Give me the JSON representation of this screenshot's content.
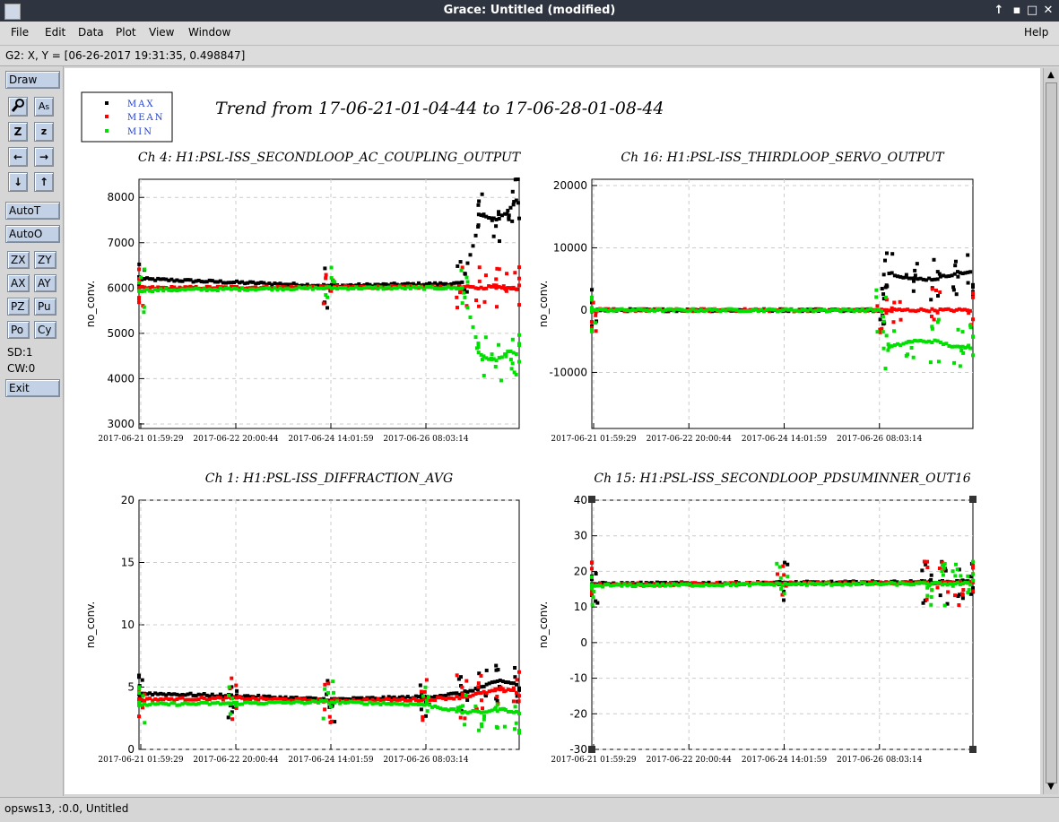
{
  "window": {
    "title": "Grace: Untitled (modified)"
  },
  "menu": [
    "File",
    "Edit",
    "Data",
    "Plot",
    "View",
    "Window"
  ],
  "menu_help": "Help",
  "coord_readout": "G2: X, Y = [06-26-2017 19:31:35, 0.498847]",
  "toolbar": {
    "draw": "Draw",
    "autot": "AutoT",
    "autoo": "AutoO",
    "zx": "ZX",
    "zy": "ZY",
    "ax": "AX",
    "ay": "AY",
    "pz": "PZ",
    "pu": "Pu",
    "po": "Po",
    "cy": "Cy",
    "sd": "SD:1",
    "cw": "CW:0",
    "exit": "Exit"
  },
  "status": "opsws13, :0.0, Untitled",
  "figure": {
    "title": "Trend from 17-06-21-01-04-44 to 17-06-28-01-08-44",
    "legend": [
      {
        "label": "MAX",
        "color": "#000000"
      },
      {
        "label": "MEAN",
        "color": "#ff0000"
      },
      {
        "label": "MIN",
        "color": "#00e000"
      }
    ]
  },
  "chart_data": [
    {
      "type": "scatter",
      "title": "Ch 4: H1:PSL-ISS_SECONDLOOP_AC_COUPLING_OUTPUT",
      "xlabel": "",
      "ylabel": "no_conv.",
      "ylim": [
        2900,
        8400
      ],
      "yticks": [
        3000,
        4000,
        5000,
        6000,
        7000,
        8000
      ],
      "xticks": [
        "2017-06-21 01:59:29",
        "2017-06-22 20:00:44",
        "2017-06-24 14:01:59",
        "2017-06-26 08:03:14"
      ],
      "grid": true,
      "series": [
        {
          "name": "MAX",
          "baseline": 6050,
          "x": [
            0.0,
            0.5,
            0.85,
            0.9,
            0.94,
            0.97,
            1.0
          ],
          "y": [
            6200,
            6050,
            6100,
            7600,
            7500,
            7700,
            8000
          ]
        },
        {
          "name": "MEAN",
          "baseline": 6000,
          "x": [
            0.0,
            0.5,
            0.85,
            0.9,
            0.94,
            0.97,
            1.0
          ],
          "y": [
            6000,
            6020,
            6020,
            6000,
            6050,
            6000,
            6000
          ]
        },
        {
          "name": "MIN",
          "baseline": 5980,
          "x": [
            0.0,
            0.5,
            0.85,
            0.9,
            0.94,
            0.97,
            1.0
          ],
          "y": [
            5950,
            6000,
            6000,
            4500,
            4400,
            4600,
            4500
          ]
        }
      ]
    },
    {
      "type": "scatter",
      "title": "Ch 16: H1:PSL-ISS_THIRDLOOP_SERVO_OUTPUT",
      "xlabel": "",
      "ylabel": "no_conv.",
      "ylim": [
        -19000,
        21000
      ],
      "yticks": [
        -10000,
        0,
        10000,
        20000
      ],
      "xticks": [
        "2017-06-21 01:59:29",
        "2017-06-22 20:00:44",
        "2017-06-24 14:01:59",
        "2017-06-26 08:03:14"
      ],
      "grid": true,
      "series": [
        {
          "name": "MAX",
          "baseline": 0,
          "x": [
            0.0,
            0.76,
            0.78,
            0.84,
            0.9,
            0.96,
            1.0
          ],
          "y": [
            0,
            0,
            6000,
            5000,
            5000,
            6000,
            6000
          ]
        },
        {
          "name": "MEAN",
          "baseline": 0,
          "x": [
            0.0,
            0.76,
            0.8,
            0.9,
            1.0
          ],
          "y": [
            0,
            0,
            0,
            0,
            0
          ]
        },
        {
          "name": "MIN",
          "baseline": 0,
          "x": [
            0.0,
            0.76,
            0.78,
            0.84,
            0.9,
            0.96,
            1.0
          ],
          "y": [
            0,
            0,
            -6000,
            -5000,
            -5000,
            -6000,
            -6000
          ]
        }
      ]
    },
    {
      "type": "scatter",
      "title": "Ch 1: H1:PSL-ISS_DIFFRACTION_AVG",
      "xlabel": "",
      "ylabel": "no_conv.",
      "ylim": [
        0,
        20
      ],
      "yticks": [
        0,
        5,
        10,
        15,
        20
      ],
      "xticks": [
        "2017-06-21 01:59:29",
        "2017-06-22 20:00:44",
        "2017-06-24 14:01:59",
        "2017-06-26 08:03:14"
      ],
      "grid": true,
      "series": [
        {
          "name": "MAX",
          "baseline": 4.2,
          "x": [
            0.0,
            0.25,
            0.5,
            0.75,
            0.85,
            0.9,
            0.95,
            1.0
          ],
          "y": [
            4.5,
            4.3,
            4.0,
            4.2,
            4.5,
            5.0,
            5.5,
            5.2
          ]
        },
        {
          "name": "MEAN",
          "baseline": 4.0,
          "x": [
            0.0,
            0.25,
            0.5,
            0.75,
            0.85,
            0.9,
            0.95,
            1.0
          ],
          "y": [
            4.0,
            4.1,
            3.9,
            4.0,
            4.2,
            4.5,
            4.8,
            4.6
          ]
        },
        {
          "name": "MIN",
          "baseline": 3.7,
          "x": [
            0.0,
            0.25,
            0.5,
            0.75,
            0.85,
            0.9,
            0.95,
            1.0
          ],
          "y": [
            3.6,
            3.7,
            3.8,
            3.6,
            3.0,
            3.0,
            3.2,
            3.0
          ]
        }
      ]
    },
    {
      "type": "scatter",
      "title": "Ch 15: H1:PSL-ISS_SECONDLOOP_PDSUMINNER_OUT16",
      "xlabel": "",
      "ylabel": "no_conv.",
      "ylim": [
        -30,
        40
      ],
      "yticks": [
        -30,
        -20,
        -10,
        0,
        10,
        20,
        30,
        40
      ],
      "xticks": [
        "2017-06-21 01:59:29",
        "2017-06-22 20:00:44",
        "2017-06-24 14:01:59",
        "2017-06-26 08:03:14"
      ],
      "grid": true,
      "series": [
        {
          "name": "MAX",
          "baseline": 16.8,
          "x": [
            0.0,
            0.5,
            0.88,
            0.92,
            0.96,
            1.0
          ],
          "y": [
            16.5,
            16.8,
            17.0,
            17.0,
            17.0,
            17.0
          ]
        },
        {
          "name": "MEAN",
          "baseline": 16.6,
          "x": [
            0.0,
            0.5,
            0.88,
            0.92,
            0.96,
            1.0
          ],
          "y": [
            16.3,
            16.6,
            16.8,
            16.8,
            16.8,
            16.8
          ]
        },
        {
          "name": "MIN",
          "baseline": 16.4,
          "x": [
            0.0,
            0.5,
            0.88,
            0.92,
            0.96,
            1.0
          ],
          "y": [
            16.0,
            16.4,
            16.5,
            16.5,
            16.5,
            16.5
          ]
        }
      ]
    }
  ]
}
